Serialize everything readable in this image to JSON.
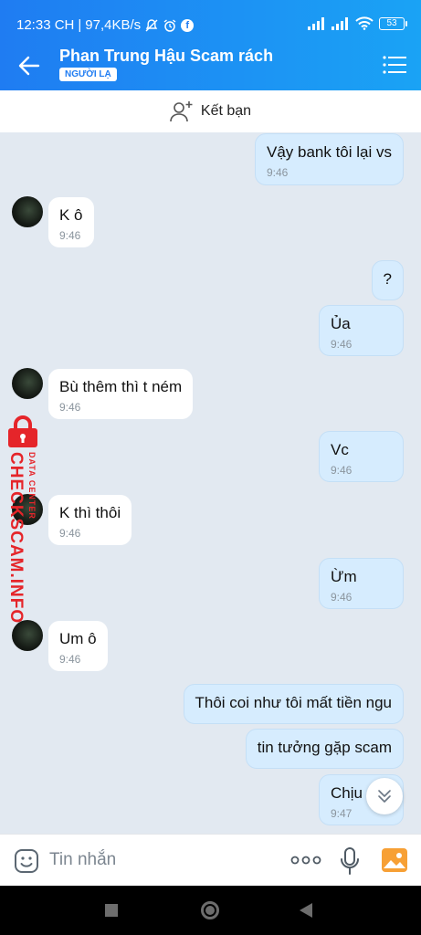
{
  "status": {
    "time": "12:33 CH",
    "speed": "97,4KB/s",
    "battery": "53",
    "fb_letter": "f"
  },
  "header": {
    "title": "Phan Trung Hậu Scam rách",
    "badge": "NGƯỜI LẠ",
    "back_icon": "arrow-left-icon",
    "menu_icon": "list-menu-icon"
  },
  "friend_bar": {
    "label": "Kết bạn",
    "icon": "add-user-icon"
  },
  "messages": [
    {
      "side": "out",
      "text": "Vậy bank tôi lại vs",
      "time": "9:46"
    },
    {
      "side": "in",
      "text": "K ô",
      "time": "9:46"
    },
    {
      "side": "out",
      "text": "?",
      "time": ""
    },
    {
      "side": "out",
      "text": "Ủa",
      "time": "9:46"
    },
    {
      "side": "in",
      "text": "Bù thêm thì t ném",
      "time": "9:46"
    },
    {
      "side": "out",
      "text": "Vc",
      "time": "9:46"
    },
    {
      "side": "in",
      "text": "K thì thôi",
      "time": "9:46"
    },
    {
      "side": "out",
      "text": "Ừm",
      "time": "9:46"
    },
    {
      "side": "in",
      "text": "Um ô",
      "time": "9:46"
    },
    {
      "side": "out",
      "text": "Thôi coi như tôi mất tiền ngu",
      "time": ""
    },
    {
      "side": "out",
      "text": "tin tưởng gặp scam",
      "time": ""
    },
    {
      "side": "out",
      "text": "Chịu",
      "time": "9:47"
    }
  ],
  "watermark": {
    "main": "CHECKSCAM.INFO",
    "sub": "DATA CENTER",
    "color": "#e5252a"
  },
  "composer": {
    "placeholder": "Tin nhắn"
  },
  "colors": {
    "header_start": "#1f7cf2",
    "header_end": "#1aa3f5",
    "chat_bg": "#e2e9f1",
    "out_bubble": "#d6ecfe",
    "in_bubble": "#ffffff"
  }
}
